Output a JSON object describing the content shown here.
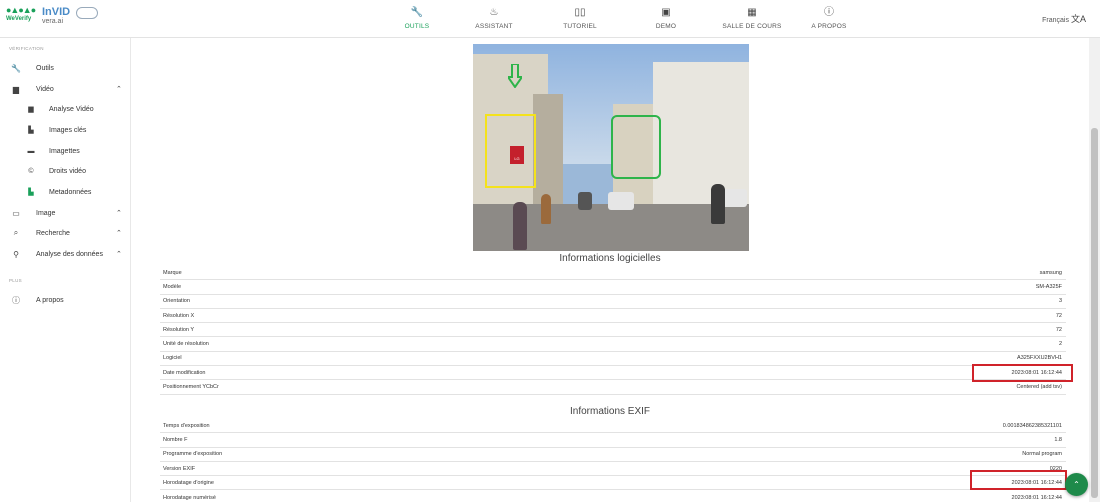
{
  "brand": {
    "logo_left": "WeVerify",
    "logo_right_1": "InVID",
    "logo_right_2": "vera.ai"
  },
  "nav": [
    {
      "label": "OUTILS",
      "icon": "wrench-icon",
      "active": true
    },
    {
      "label": "ASSISTANT",
      "icon": "assistant-icon",
      "active": false
    },
    {
      "label": "TUTORIEL",
      "icon": "book-icon",
      "active": false
    },
    {
      "label": "DEMO",
      "icon": "demo-icon",
      "active": false
    },
    {
      "label": "SALLE DE COURS",
      "icon": "classroom-icon",
      "active": false
    },
    {
      "label": "A PROPOS",
      "icon": "info-icon",
      "active": false
    }
  ],
  "language": "Français",
  "sidebar": {
    "section1": "VÉRIFICATION",
    "section2": "PLUS",
    "items": [
      {
        "label": "Outils",
        "icon": "wrench-icon"
      },
      {
        "label": "Vidéo",
        "icon": "video-icon"
      },
      {
        "label": "Analyse Vidéo",
        "icon": "video-analysis-icon"
      },
      {
        "label": "Images clés",
        "icon": "keyframes-icon"
      },
      {
        "label": "Imagettes",
        "icon": "thumbnails-icon"
      },
      {
        "label": "Droits vidéo",
        "icon": "copyright-icon"
      },
      {
        "label": "Metadonnées",
        "icon": "file-icon"
      },
      {
        "label": "Image",
        "icon": "image-icon"
      },
      {
        "label": "Recherche",
        "icon": "search-icon"
      },
      {
        "label": "Analyse des données",
        "icon": "data-analysis-icon"
      },
      {
        "label": "A propos",
        "icon": "info-icon"
      }
    ]
  },
  "software_section": {
    "title": "Informations logicielles",
    "rows": [
      {
        "label": "Marque",
        "value": "samsung"
      },
      {
        "label": "Modèle",
        "value": "SM-A325F"
      },
      {
        "label": "Orientation",
        "value": "3"
      },
      {
        "label": "Résolution X",
        "value": "72"
      },
      {
        "label": "Résolution Y",
        "value": "72"
      },
      {
        "label": "Unité de résolution",
        "value": "2"
      },
      {
        "label": "Logiciel",
        "value": "A325FXXU2BVH1"
      },
      {
        "label": "Date modification",
        "value": "2023:08:01 16:12:44"
      },
      {
        "label": "Positionnement YCbCr",
        "value": "Centered (add tsv)"
      }
    ]
  },
  "exif_section": {
    "title": "Informations EXIF",
    "rows": [
      {
        "label": "Temps d'exposition",
        "value": "0.001834862385321101"
      },
      {
        "label": "Nombre F",
        "value": "1.8"
      },
      {
        "label": "Programme d'exposition",
        "value": "Normal program"
      },
      {
        "label": "Version EXIF",
        "value": "0220"
      },
      {
        "label": "Horodatage d'origine",
        "value": "2023:08:01 16:12:44"
      },
      {
        "label": "Horodatage numérisé",
        "value": "2023:08:01 16:12:44"
      }
    ]
  },
  "photo_sign": "LG",
  "colors": {
    "accent": "#1aa05a",
    "highlight": "#d0232a",
    "box_yellow": "#f4e21c",
    "box_green": "#2eb44a"
  }
}
